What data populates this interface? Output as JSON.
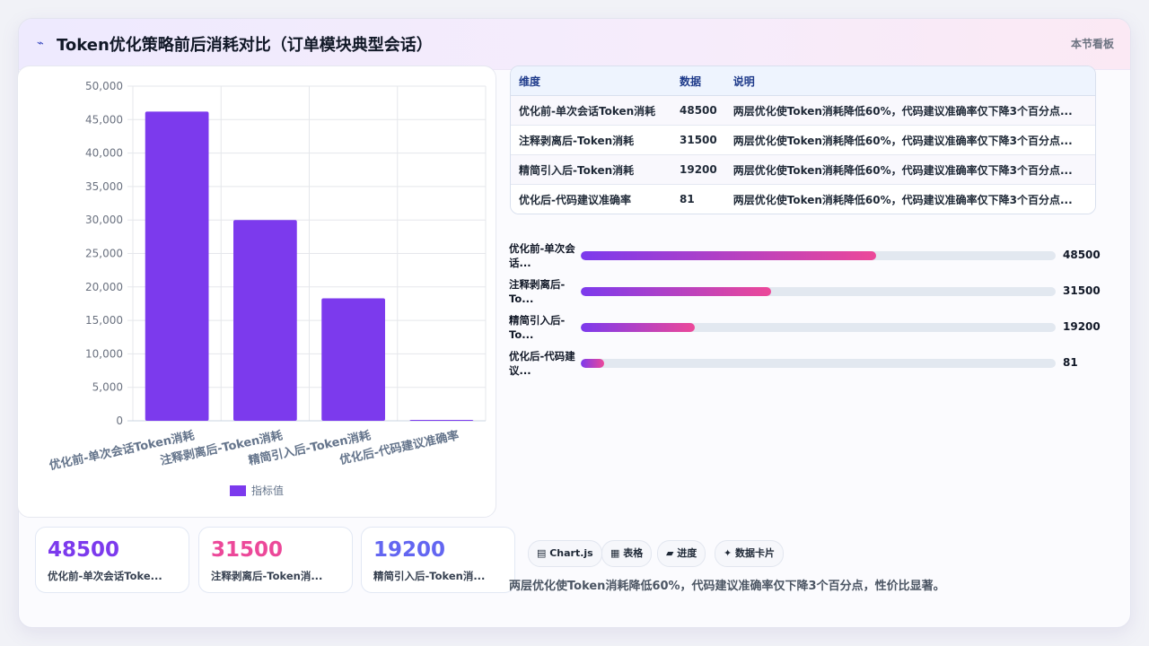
{
  "header": {
    "icon": "trend-icon",
    "title": "Token优化策略前后消耗对比（订单模块典型会话）",
    "section_label": "本节看板"
  },
  "chart_data": {
    "type": "bar",
    "categories": [
      "优化前-单次会话Token消耗",
      "注释剥离后-Token消耗",
      "精简引入后-Token消耗",
      "优化后-代码建议准确率"
    ],
    "series": [
      {
        "name": "指标值",
        "values": [
          46200,
          30000,
          18300,
          81
        ]
      }
    ],
    "ylim": [
      0,
      50000
    ],
    "yticks": [
      "0",
      "5,000",
      "10,000",
      "15,000",
      "20,000",
      "25,000",
      "30,000",
      "35,000",
      "40,000",
      "45,000",
      "50,000"
    ],
    "legend_position": "bottom",
    "grid": true,
    "colors": {
      "bar": "#7c3aed"
    }
  },
  "kpis": [
    {
      "value": "48500",
      "label": "优化前-单次会话Toke...",
      "color": "#7c3aed"
    },
    {
      "value": "31500",
      "label": "注释剥离后-Token消...",
      "color": "#ec4899"
    },
    {
      "value": "19200",
      "label": "精简引入后-Token消...",
      "color": "#6366f1"
    }
  ],
  "table": {
    "headers": [
      "维度",
      "数据",
      "说明"
    ],
    "rows": [
      [
        "优化前-单次会话Token消耗",
        "48500",
        "两层优化使Token消耗降低60%，代码建议准确率仅下降3个百分点..."
      ],
      [
        "注释剥离后-Token消耗",
        "31500",
        "两层优化使Token消耗降低60%，代码建议准确率仅下降3个百分点..."
      ],
      [
        "精简引入后-Token消耗",
        "19200",
        "两层优化使Token消耗降低60%，代码建议准确率仅下降3个百分点..."
      ],
      [
        "优化后-代码建议准确率",
        "81",
        "两层优化使Token消耗降低60%，代码建议准确率仅下降3个百分点..."
      ]
    ]
  },
  "progress": [
    {
      "label": "优化前-单次会话...",
      "value": "48500",
      "fraction": 0.622
    },
    {
      "label": "注释剥离后-To...",
      "value": "31500",
      "fraction": 0.4
    },
    {
      "label": "精简引入后-To...",
      "value": "19200",
      "fraction": 0.24
    },
    {
      "label": "优化后-代码建议...",
      "value": "81",
      "fraction": 0.05
    }
  ],
  "chips": [
    "▤ Chart.js",
    "▦ 表格",
    "▰ 进度",
    "✦ 数据卡片"
  ],
  "summary": "两层优化使Token消耗降低60%，代码建议准确率仅下降3个百分点，性价比显著。"
}
